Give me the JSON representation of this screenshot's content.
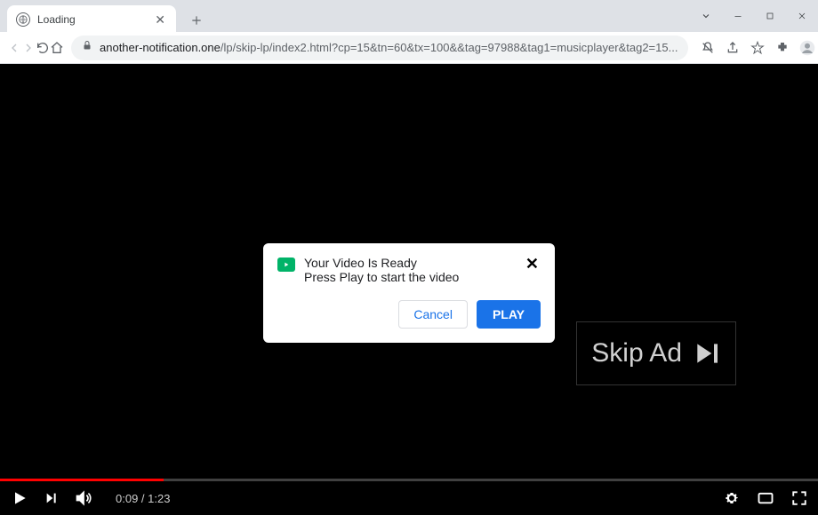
{
  "tab": {
    "title": "Loading"
  },
  "url": {
    "domain": "another-notification.one",
    "path": "/lp/skip-lp/index2.html?cp=15&tn=60&tx=100&&tag=97988&tag1=musicplayer&tag2=15..."
  },
  "video": {
    "current_time": "0:09",
    "duration": "1:23"
  },
  "skip_ad": {
    "label": "Skip Ad"
  },
  "modal": {
    "title": "Your Video Is Ready",
    "subtitle": "Press Play to start the video",
    "cancel_label": "Cancel",
    "play_label": "PLAY"
  }
}
